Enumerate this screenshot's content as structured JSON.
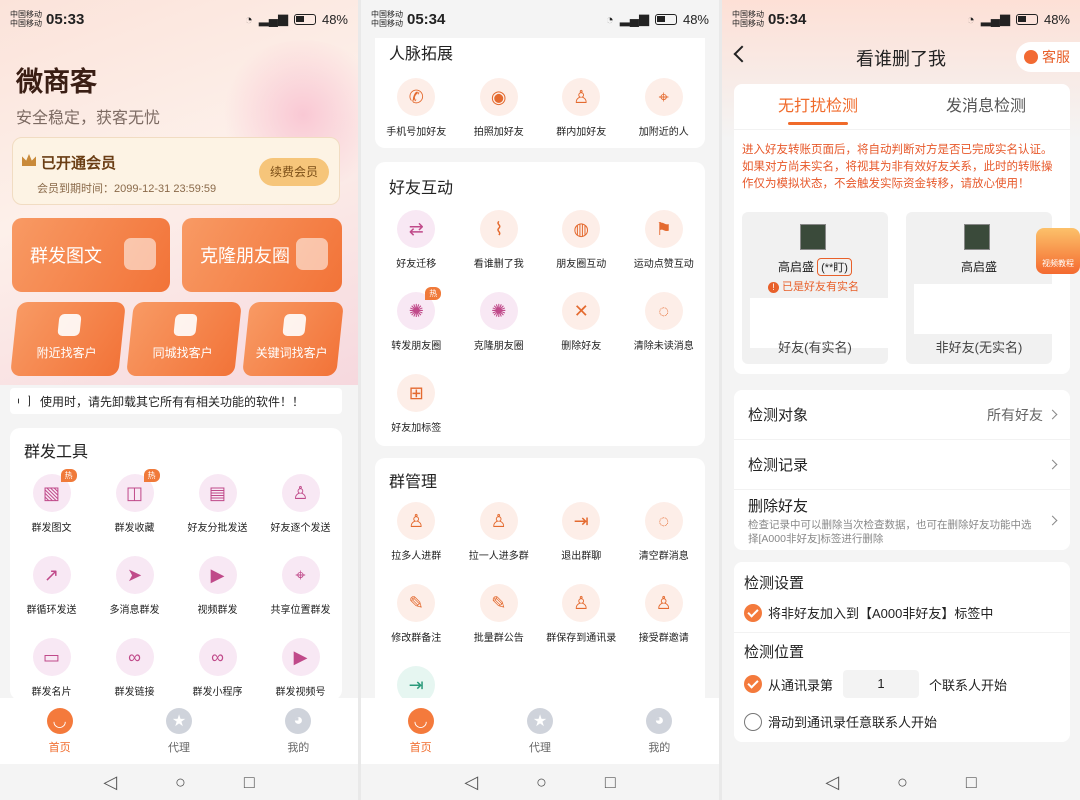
{
  "screens": {
    "s1": {
      "status": {
        "carrier1": "中国移动",
        "carrier2": "中国移动",
        "time": "05:33",
        "battery": "48%"
      },
      "app_title": "微商客",
      "app_subtitle": "安全稳定，获客无忧",
      "vip": {
        "title": "已开通会员",
        "expiry_label": "会员到期时间：2099-12-31 23:59:59",
        "renew_label": "续费会员"
      },
      "big_buttons": [
        "群发图文",
        "克隆朋友圈"
      ],
      "small_buttons": [
        "附近找客户",
        "同城找客户",
        "关键词找客户"
      ],
      "notice": "使用时，请先卸载其它所有有相关功能的软件！！",
      "tools_title": "群发工具",
      "tools": [
        "群发图文",
        "群发收藏",
        "好友分批发送",
        "好友逐个发送",
        "群循环发送",
        "多消息群发",
        "视频群发",
        "共享位置群发",
        "群发名片",
        "群发链接",
        "群发小程序",
        "群发视频号"
      ],
      "hot_label": "热"
    },
    "s2": {
      "status": {
        "carrier1": "中国移动",
        "carrier2": "中国移动",
        "time": "05:34",
        "battery": "48%"
      },
      "network_title": "人脉拓展",
      "network": [
        "手机号加好友",
        "拍照加好友",
        "群内加好友",
        "加附近的人"
      ],
      "friend_title": "好友互动",
      "friend": [
        "好友迁移",
        "看谁删了我",
        "朋友圈互动",
        "运动点赞互动",
        "转发朋友圈",
        "克隆朋友圈",
        "删除好友",
        "清除未读消息",
        "好友加标签"
      ],
      "group_title": "群管理",
      "group": [
        "拉多人进群",
        "拉一人进多群",
        "退出群聊",
        "清空群消息",
        "修改群备注",
        "批量群公告",
        "群保存到通讯录",
        "接受群邀请"
      ],
      "hot_label": "热"
    },
    "s3": {
      "status": {
        "carrier1": "中国移动",
        "carrier2": "中国移动",
        "time": "05:34",
        "battery": "48%"
      },
      "title": "看谁删了我",
      "service": "客服",
      "tabs": [
        "无打扰检测",
        "发消息检测"
      ],
      "warning": "进入好友转账页面后，将自动判断对方是否已完成实名认证。如果对方尚未实名，将视其为非有效好友关系，此时的转账操作仅为模拟状态，不会触发实际资金转移，请放心使用！",
      "demo_left": {
        "name": "高启盛",
        "tag": "(**盯)",
        "error": "已是好友有实名",
        "caption": "好友(有实名)"
      },
      "demo_right": {
        "name": "高启盛",
        "caption": "非好友(无实名)"
      },
      "tutorial": "视频教程",
      "rows": {
        "target_label": "检测对象",
        "target_value": "所有好友",
        "record_label": "检测记录",
        "delete_label": "删除好友",
        "delete_desc": "检查记录中可以删除当次检查数据，也可在删除好友功能中选择[A000非好友]标签进行删除"
      },
      "settings_title": "检测设置",
      "settings_option": "将非好友加入到【A000非好友】标签中",
      "position_title": "检测位置",
      "position_prefix": "从通讯录第",
      "position_value": "1",
      "position_suffix": "个联系人开始",
      "position_alt": "滑动到通讯录任意联系人开始"
    }
  },
  "tabbar": [
    "首页",
    "代理",
    "我的"
  ],
  "colors": {
    "accent": "#f06a2a",
    "accent_light": "#fdeee8"
  }
}
